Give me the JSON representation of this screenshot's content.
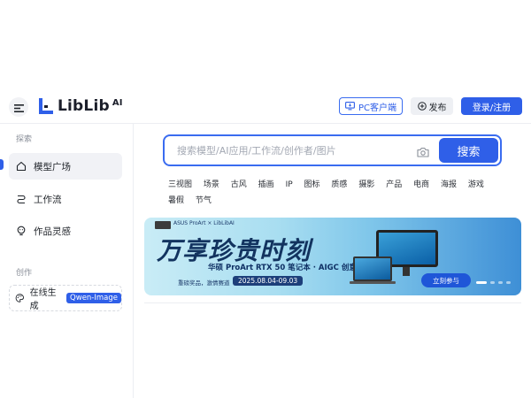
{
  "app": {
    "logo_text": "LibLib",
    "logo_suffix": "AI"
  },
  "header": {
    "pc_client_label": "PC客户端",
    "publish_label": "发布",
    "login_label": "登录/注册"
  },
  "sidebar": {
    "section_explore": "探索",
    "items": [
      {
        "label": "模型广场",
        "icon": "house-icon",
        "active": true
      },
      {
        "label": "工作流",
        "icon": "workflow-icon",
        "active": false
      },
      {
        "label": "作品灵感",
        "icon": "lightbulb-icon",
        "active": false
      }
    ],
    "section_create": "创作",
    "online_generate": {
      "label": "在线生成",
      "badge": "Qwen-Image"
    }
  },
  "search": {
    "placeholder": "搜索模型/AI应用/工作流/创作者/图片",
    "button_label": "搜索"
  },
  "tags": [
    "三视图",
    "场景",
    "古风",
    "插画",
    "IP",
    "图标",
    "质感",
    "摄影",
    "产品",
    "电商",
    "海报",
    "游戏",
    "暑假",
    "节气"
  ],
  "banner": {
    "brand": "ASUS ProArt × LibLibAI",
    "slogan": "万享珍贵时刻",
    "title": "华硕 ProArt RTX 50 笔记本 · AIGC 创意大赛",
    "subtitle": "重磅奖品，激情赛道",
    "dates": "2025.08.04-09.03",
    "cta": "立刻参与"
  },
  "colors": {
    "accent": "#2f5fe8",
    "sidebar_active_bg": "#f1f2f6"
  }
}
